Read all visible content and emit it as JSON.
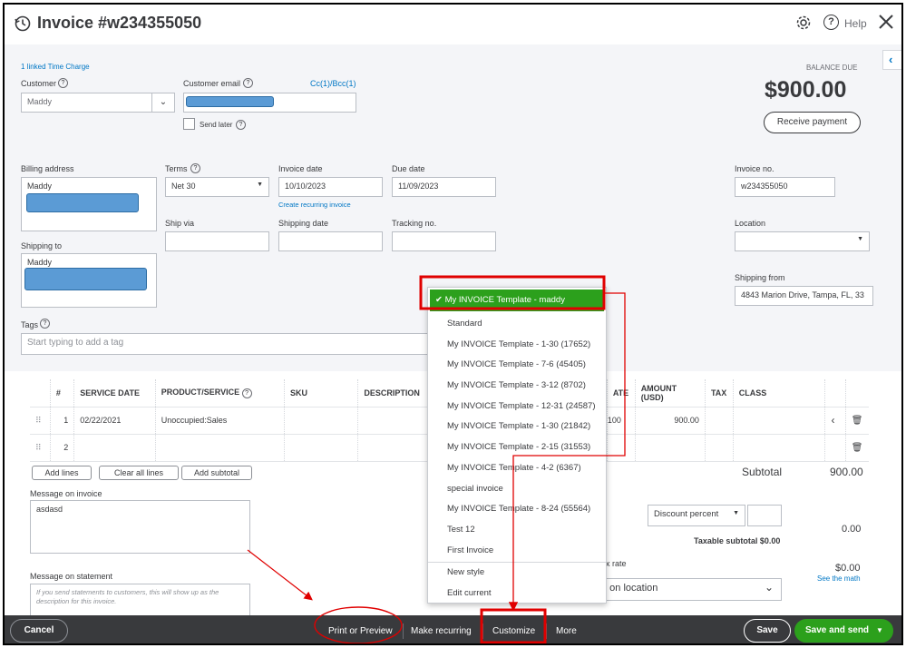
{
  "header": {
    "title": "Invoice #w234355050",
    "help_label": "Help"
  },
  "top": {
    "linked_time_charge": "1 linked Time Charge",
    "customer_label": "Customer",
    "customer_value": "Maddy",
    "email_label": "Customer email",
    "cc_bcc": "Cc(1)/Bcc(1)",
    "send_later": "Send later",
    "balance_due_label": "BALANCE DUE",
    "balance_due_amount": "$900.00",
    "receive_payment": "Receive payment"
  },
  "details": {
    "billing_label": "Billing address",
    "billing_name": "Maddy",
    "shipping_to_label": "Shipping to",
    "shipping_name": "Maddy",
    "terms_label": "Terms",
    "terms_value": "Net 30",
    "invoice_date_label": "Invoice date",
    "invoice_date": "10/10/2023",
    "recurring_link": "Create recurring invoice",
    "due_date_label": "Due date",
    "due_date": "11/09/2023",
    "invoice_no_label": "Invoice no.",
    "invoice_no": "w234355050",
    "ship_via_label": "Ship via",
    "shipping_date_label": "Shipping date",
    "tracking_label": "Tracking no.",
    "location_label": "Location",
    "shipping_from_label": "Shipping from",
    "shipping_from": "4843  Marion Drive, Tampa, FL, 33",
    "tags_label": "Tags",
    "tags_placeholder": "Start typing to add a tag"
  },
  "table": {
    "headers": {
      "num": "#",
      "service_date": "SERVICE DATE",
      "product": "PRODUCT/SERVICE",
      "sku": "SKU",
      "description": "DESCRIPTION",
      "rate": "ATE",
      "amount": "AMOUNT (USD)",
      "tax": "TAX",
      "class": "CLASS"
    },
    "rows": [
      {
        "num": "1",
        "service_date": "02/22/2021",
        "product": "Unoccupied:Sales",
        "rate": "100",
        "amount": "900.00"
      },
      {
        "num": "2",
        "service_date": "",
        "product": "",
        "rate": "",
        "amount": ""
      }
    ]
  },
  "actions": {
    "add_lines": "Add lines",
    "clear_all_lines": "Clear all lines",
    "add_subtotal": "Add subtotal"
  },
  "message": {
    "invoice_label": "Message on invoice",
    "invoice_text": "asdasd",
    "statement_label": "Message on statement",
    "statement_placeholder": "If you send statements to customers, this will show up as the description for this invoice."
  },
  "totals": {
    "subtotal_label": "Subtotal",
    "subtotal_value": "900.00",
    "discount_select": "Discount percent",
    "discount_value": "0.00",
    "taxable_subtotal": "Taxable subtotal $0.00",
    "tax_rate_partial": "ax rate",
    "based_on_location": "d on location",
    "tax_value": "$0.00",
    "see_the_math": "See the math"
  },
  "template_dropdown": {
    "selected": "My INVOICE Template - maddy",
    "items": [
      "Standard",
      "My INVOICE Template - 1-30 (17652)",
      "My INVOICE Template - 7-6 (45405)",
      "My INVOICE Template - 3-12 (8702)",
      "My INVOICE Template - 12-31 (24587)",
      "My INVOICE Template - 1-30 (21842)",
      "My INVOICE Template - 2-15 (31553)",
      "My INVOICE Template - 4-2 (6367)",
      "special invoice",
      "My INVOICE Template - 8-24 (55564)",
      "Test 12",
      "First Invoice"
    ],
    "new_style": "New style",
    "edit_current": "Edit current"
  },
  "footer": {
    "cancel": "Cancel",
    "print_preview": "Print or Preview",
    "make_recurring": "Make recurring",
    "customize": "Customize",
    "more": "More",
    "save": "Save",
    "save_and_send": "Save and send"
  },
  "colors": {
    "green": "#2ca01c",
    "annotation_red": "#e00000",
    "footer_bg": "#393a3d",
    "link_blue": "#0077c5",
    "redaction_blue": "#5b9bd5"
  }
}
